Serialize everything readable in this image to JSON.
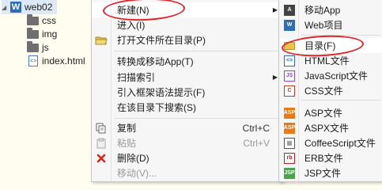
{
  "tree": {
    "root": "web02",
    "items": [
      {
        "label": "css",
        "type": "folder"
      },
      {
        "label": "img",
        "type": "folder"
      },
      {
        "label": "js",
        "type": "folder"
      },
      {
        "label": "index.html",
        "type": "file"
      }
    ]
  },
  "menu": {
    "items": {
      "new": {
        "label": "新建(N)"
      },
      "enter": {
        "label": "进入(I)"
      },
      "open_dir": {
        "label": "打开文件所在目录(P)"
      },
      "convert_app": {
        "label": "转换成移动App(T)"
      },
      "scan_index": {
        "label": "扫描索引"
      },
      "framework_hint": {
        "label": "引入框架语法提示(F)"
      },
      "search_dir": {
        "label": "在该目录下搜索(S)"
      },
      "copy": {
        "label": "复制",
        "shortcut": "Ctrl+C"
      },
      "paste": {
        "label": "粘贴",
        "shortcut": "Ctrl+V"
      },
      "delete": {
        "label": "删除(D)"
      },
      "move": {
        "label": "移动(V)..."
      }
    }
  },
  "submenu": {
    "items": [
      {
        "label": "移动App",
        "icon": "app-icon"
      },
      {
        "label": "Web项目",
        "icon": "w-icon"
      },
      {
        "label": "目录(F)",
        "icon": "folder-icon"
      },
      {
        "label": "HTML文件",
        "icon": "html-icon"
      },
      {
        "label": "JavaScript文件",
        "icon": "js-icon"
      },
      {
        "label": "CSS文件",
        "icon": "css-icon"
      },
      {
        "label": "ASP文件",
        "icon": "asp-icon"
      },
      {
        "label": "ASPX文件",
        "icon": "aspx-icon"
      },
      {
        "label": "CoffeeScript文件",
        "icon": "coffee-icon"
      },
      {
        "label": "ERB文件",
        "icon": "erb-icon"
      },
      {
        "label": "JSP文件",
        "icon": "jsp-icon"
      }
    ]
  },
  "colors": {
    "annotation": "#e0262a",
    "tree_bg": "#fffdf0",
    "menu_bg": "#f6f6f6"
  }
}
